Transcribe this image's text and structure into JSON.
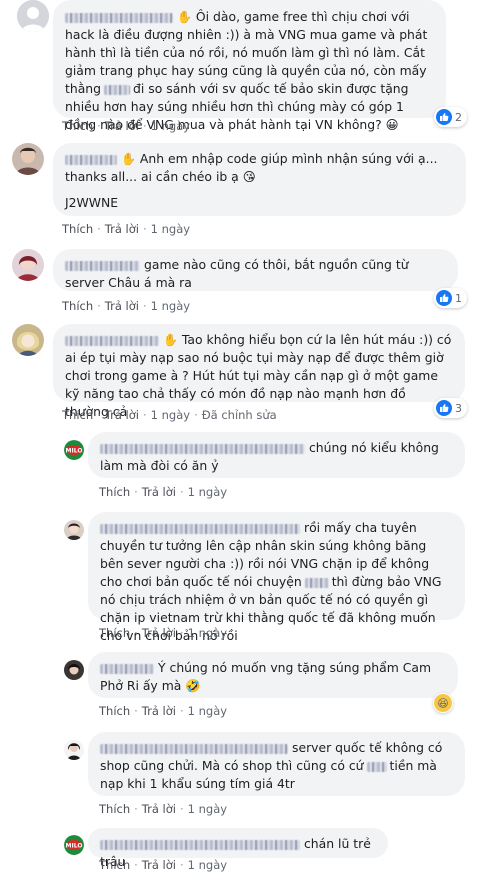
{
  "actions": {
    "like": "Thích",
    "reply": "Trả lời",
    "edited": "Đã chỉnh sửa"
  },
  "comments": [
    {
      "text": "Ôi dào, game free thì chịu chơi với hack là điều đượng nhiên :)) à mà VNG mua game và phát hành thì là tiền của nó rồi, nó muốn làm gì thì nó làm. Cắt giảm trang phục hay súng cũng là quyền của nó, còn mấy thằng",
      "text_b": "đi so sánh với sv quốc tế bảo skin được tặng nhiều hơn hay súng nhiều hơn thì chúng mày có góp 1 đồng nào để VNG mua và phát hành tại VN không?",
      "emoji": "😀",
      "time": "1 ngày",
      "reactions": "2"
    },
    {
      "text": "Anh em nhập code giúp mình nhận súng với ạ... thanks all... ai cần chéo ib ạ",
      "emoji": "😘",
      "code": "J2WWNE",
      "time": "1 ngày"
    },
    {
      "text": "game nào cũng có thôi, bắt nguồn cũng từ server Châu á mà ra",
      "time": "1 ngày",
      "reactions": "1"
    },
    {
      "text": "Tao không hiểu bọn cứ la lên hút máu :)) có ai ép tụi mày nạp sao nó buộc tụi mày nạp để được thêm giờ chơi trong game à ? Hút hút tụi mày cần nạp gì ở một game kỹ năng tao chả thấy có món đồ nạp nào mạnh hơn đồ thường cả",
      "time": "1 ngày",
      "reactions": "3"
    }
  ],
  "replies": [
    {
      "text": "chúng nó kiểu không làm mà đòi có ăn ỷ",
      "time": "1 ngày"
    },
    {
      "text": "rồi mấy cha tuyên chuyền tư tưởng lên cập nhân skin súng không băng bên sever người cha :)) rồi nói VNG chặn ip để không cho chơi bản quốc tế nói chuyện",
      "text_b": "thì đừng bảo VNG nó chịu trách nhiệm ở vn bản quốc tế nó có quyền gì chặn ip vietnam trừ khi thằng quốc tế đã không muốn cho vn chơi bản nó rồi",
      "time": "1 ngày"
    },
    {
      "text": "Ý chúng nó muốn vng tặng súng phẩm Cam Phở Ri ấy mà",
      "emoji": "🤣",
      "time": "1 ngày"
    },
    {
      "text": "server quốc tế không có shop cũng chửi. Mà có shop thì cũng có cứ",
      "text_b": "tiền mà nạp khi 1 khẩu súng tím giá 4tr",
      "time": "1 ngày"
    },
    {
      "text": "chán lũ trẻ trâu",
      "time": "1 ngày"
    }
  ],
  "icons": {
    "like": "thumbs-up-icon",
    "haha": "laughing-face-icon",
    "hand": "raised-hand-icon"
  },
  "colors": {
    "bubble": "#f2f3f5",
    "like_blue": "#1877f2",
    "meta_text": "#616770"
  }
}
